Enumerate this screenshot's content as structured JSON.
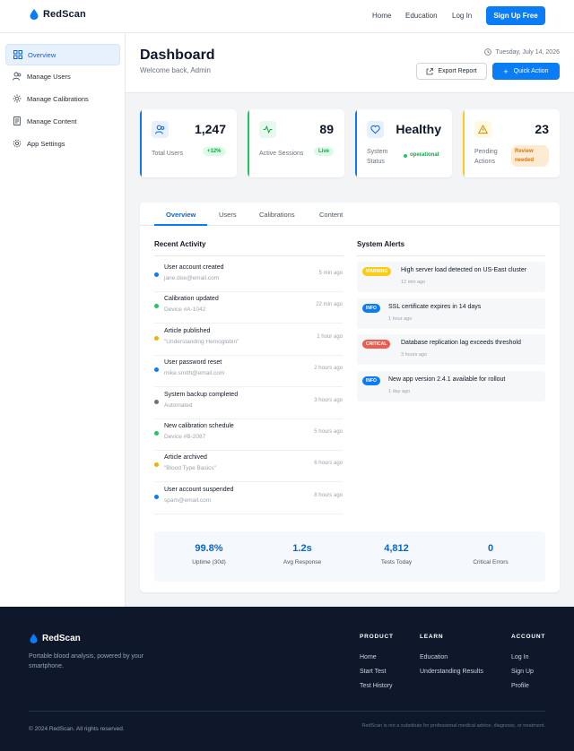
{
  "brand": {
    "name": "RedScan"
  },
  "topnav": {
    "home": "Home",
    "education": "Education",
    "login": "Log In",
    "signup": "Sign Up Free"
  },
  "sidebar": {
    "items": [
      {
        "label": "Overview",
        "icon": "grid-icon"
      },
      {
        "label": "Manage Users",
        "icon": "users-icon"
      },
      {
        "label": "Manage Calibrations",
        "icon": "calibration-icon"
      },
      {
        "label": "Manage Content",
        "icon": "document-icon"
      },
      {
        "label": "App Settings",
        "icon": "gear-icon"
      }
    ]
  },
  "header": {
    "title": "Dashboard",
    "welcome": "Welcome back, Admin",
    "date": "Tuesday, July 14, 2026",
    "export_label": "Export Report",
    "quick_label": "Quick Action"
  },
  "stats": [
    {
      "value": "1,247",
      "label": "Total Users",
      "badge": "+12%",
      "color": "#0a7cf5"
    },
    {
      "value": "89",
      "label": "Active Sessions",
      "badge": "Live",
      "color": "#22c55e"
    },
    {
      "value": "Healthy",
      "label": "System Status",
      "badge": "operational",
      "color": "#0a7cf5"
    },
    {
      "value": "23",
      "label": "Pending Actions",
      "badge": "Review needed",
      "color": "#facc15"
    }
  ],
  "tabs": [
    "Overview",
    "Users",
    "Calibrations",
    "Content"
  ],
  "recent_activity": {
    "title": "Recent Activity",
    "items": [
      {
        "title": "User account created",
        "sub": "jane.doe@email.com",
        "time": "5 min ago",
        "color": "#0a7cf5"
      },
      {
        "title": "Calibration updated",
        "sub": "Device #A-1042",
        "time": "22 min ago",
        "color": "#22c55e"
      },
      {
        "title": "Article published",
        "sub": "\"Understanding Hemoglobin\"",
        "time": "1 hour ago",
        "color": "#eab308"
      },
      {
        "title": "User password reset",
        "sub": "mike.smith@email.com",
        "time": "2 hours ago",
        "color": "#0a7cf5"
      },
      {
        "title": "System backup completed",
        "sub": "Automated",
        "time": "3 hours ago",
        "color": "#6b7280"
      },
      {
        "title": "New calibration schedule",
        "sub": "Device #B-2087",
        "time": "5 hours ago",
        "color": "#22c55e"
      },
      {
        "title": "Article archived",
        "sub": "\"Blood Type Basics\"",
        "time": "6 hours ago",
        "color": "#eab308"
      },
      {
        "title": "User account suspended",
        "sub": "spam@email.com",
        "time": "8 hours ago",
        "color": "#0a7cf5"
      }
    ]
  },
  "system_alerts": {
    "title": "System Alerts",
    "items": [
      {
        "tag": "WARNING",
        "text": "High server load detected on US-East cluster",
        "time": "12 min ago",
        "color": "#facc15"
      },
      {
        "tag": "INFO",
        "text": "SSL certificate expires in 14 days",
        "time": "1 hour ago",
        "color": "#0a7cf5"
      },
      {
        "tag": "CRITICAL",
        "text": "Database replication lag exceeds threshold",
        "time": "3 hours ago",
        "color": "#ef5a4c"
      },
      {
        "tag": "INFO",
        "text": "New app version 2.4.1 available for rollout",
        "time": "1 day ago",
        "color": "#0a7cf5"
      }
    ]
  },
  "metrics": [
    {
      "value": "99.8%",
      "label": "Uptime (30d)"
    },
    {
      "value": "1.2s",
      "label": "Avg Response"
    },
    {
      "value": "4,812",
      "label": "Tests Today"
    },
    {
      "value": "0",
      "label": "Critical Errors"
    }
  ],
  "footer": {
    "brand": "RedScan",
    "tagline": "Portable blood analysis, powered by your smartphone.",
    "product": {
      "heading": "PRODUCT",
      "links": [
        "Home",
        "Start Test",
        "Test History"
      ]
    },
    "learn": {
      "heading": "LEARN",
      "links": [
        "Education",
        "Understanding Results"
      ]
    },
    "account": {
      "heading": "ACCOUNT",
      "links": [
        "Log In",
        "Sign Up",
        "Profile"
      ]
    },
    "copyright": "© 2024 RedScan. All rights reserved.",
    "disclaimer": "RedScan is not a substitute for professional medical advice, diagnosis, or treatment."
  }
}
